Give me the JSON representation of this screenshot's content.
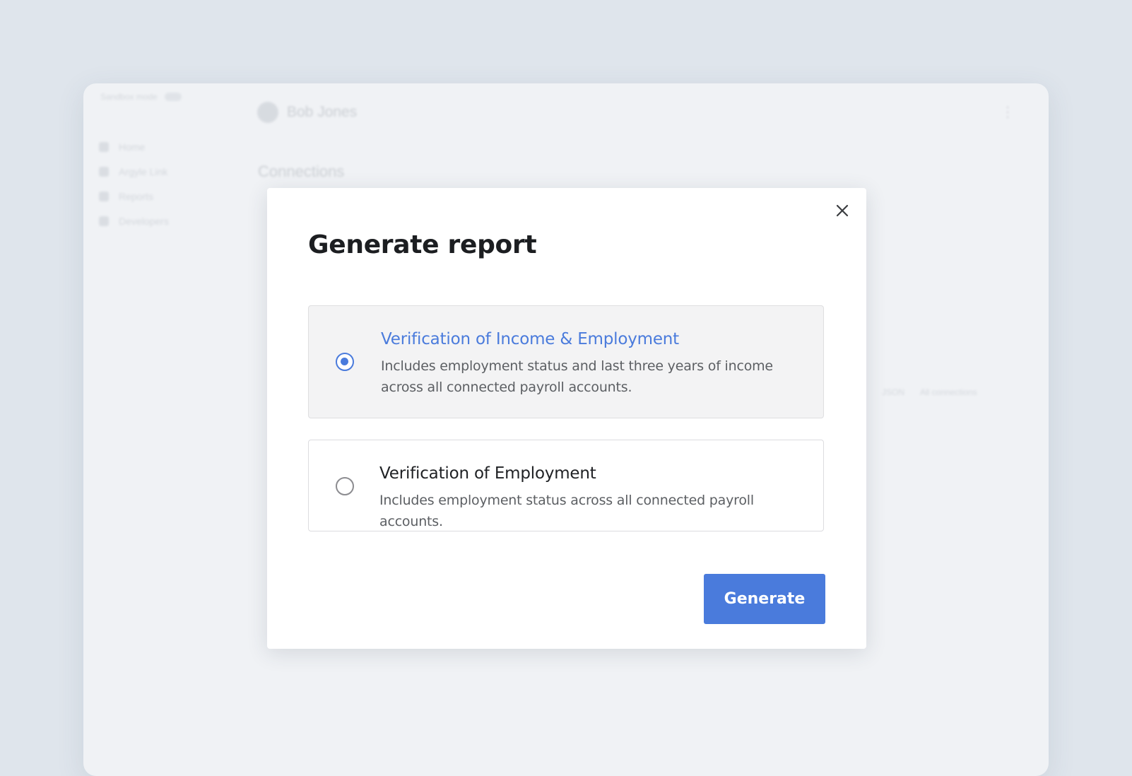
{
  "background": {
    "sandbox_label": "Sandbox mode",
    "nav_items": [
      {
        "label": "Home",
        "icon": "home-icon"
      },
      {
        "label": "Argyle Link",
        "icon": "link-icon"
      },
      {
        "label": "Reports",
        "icon": "report-icon"
      },
      {
        "label": "Developers",
        "icon": "code-icon"
      }
    ],
    "user_name": "Bob Jones",
    "section_title": "Connections",
    "json_label": "JSON",
    "filter_label": "All connections"
  },
  "modal": {
    "title": "Generate report",
    "close_icon": "close-icon",
    "options": [
      {
        "title": "Verification of Income & Employment",
        "description": "Includes employment status and last three years of income across all connected payroll accounts.",
        "selected": true
      },
      {
        "title": "Verification of Employment",
        "description": "Includes employment status across all connected payroll accounts.",
        "selected": false
      }
    ],
    "generate_label": "Generate"
  },
  "colors": {
    "accent": "#4a7bdc",
    "page_background": "#dfe5ec",
    "app_background": "#f0f2f5",
    "selected_option_background": "#f3f3f4"
  }
}
